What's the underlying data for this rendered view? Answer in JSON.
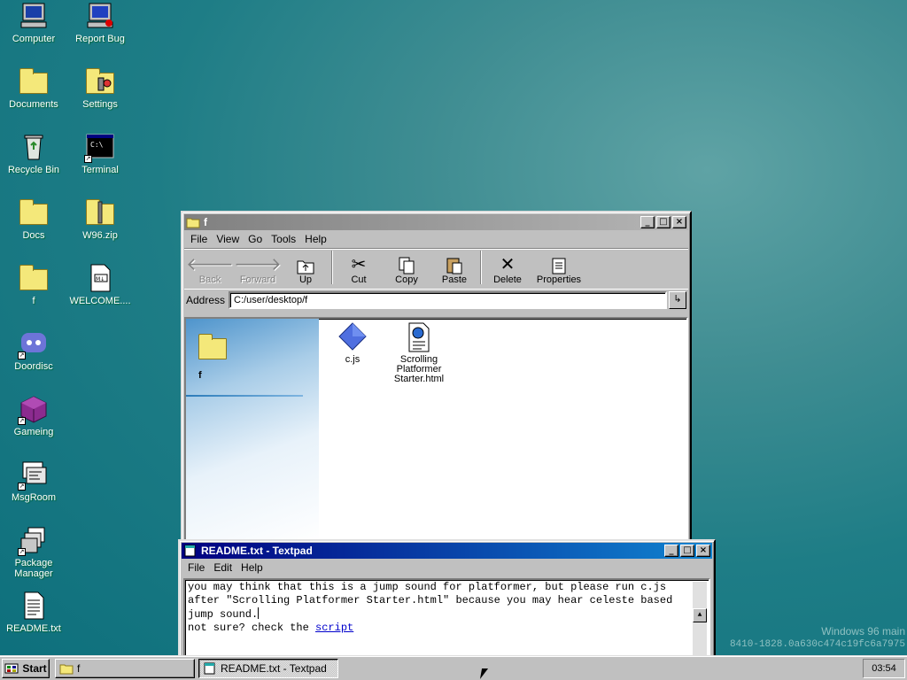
{
  "desktop": {
    "icons": [
      {
        "label": "Computer",
        "icon": "computer-icon"
      },
      {
        "label": "Report Bug",
        "icon": "report-bug-icon"
      },
      {
        "label": "Documents",
        "icon": "documents-folder-icon"
      },
      {
        "label": "Settings",
        "icon": "settings-icon"
      },
      {
        "label": "Recycle Bin",
        "icon": "recycle-bin-icon"
      },
      {
        "label": "Terminal",
        "icon": "terminal-icon"
      },
      {
        "label": "Docs",
        "icon": "folder-icon"
      },
      {
        "label": "W96.zip",
        "icon": "zip-folder-icon"
      },
      {
        "label": "f",
        "icon": "folder-icon"
      },
      {
        "label": "WELCOME....",
        "icon": "markdown-file-icon"
      },
      {
        "label": "Doordisc",
        "icon": "doordisc-icon"
      },
      {
        "label": "Gameing",
        "icon": "cube-icon"
      },
      {
        "label": "MsgRoom",
        "icon": "msgroom-icon"
      },
      {
        "label": "Package Manager",
        "icon": "package-manager-icon"
      },
      {
        "label": "README.txt",
        "icon": "text-file-icon"
      }
    ],
    "watermark_line1": "Windows 96 main",
    "watermark_line2": "8410-1828.0a630c474c19fc6a7975"
  },
  "explorer": {
    "title": "f",
    "menu": [
      "File",
      "View",
      "Go",
      "Tools",
      "Help"
    ],
    "toolbar": {
      "back": "Back",
      "forward": "Forward",
      "up": "Up",
      "cut": "Cut",
      "copy": "Copy",
      "paste": "Paste",
      "delete": "Delete",
      "properties": "Properties"
    },
    "address_label": "Address",
    "address_value": "C:/user/desktop/f",
    "panel_title": "f",
    "files": [
      {
        "name": "c.js",
        "icon": "js-file-icon"
      },
      {
        "name": "Scrolling Platformer Starter.html",
        "icon": "html-file-icon"
      }
    ]
  },
  "textpad": {
    "title": "README.txt - Textpad",
    "menu": [
      "File",
      "Edit",
      "Help"
    ],
    "text_line1": "you may think that this is a jump sound for platformer, but please run c.js",
    "text_line2": "after \"Scrolling Platformer Starter.html\" because you may hear celeste based",
    "text_line3": "jump sound.",
    "text_line4": "not sure? check the ",
    "link_text": "script"
  },
  "taskbar": {
    "start_label": "Start",
    "tasks": [
      {
        "label": "f"
      },
      {
        "label": "README.txt - Textpad"
      }
    ],
    "clock": "03:54"
  }
}
